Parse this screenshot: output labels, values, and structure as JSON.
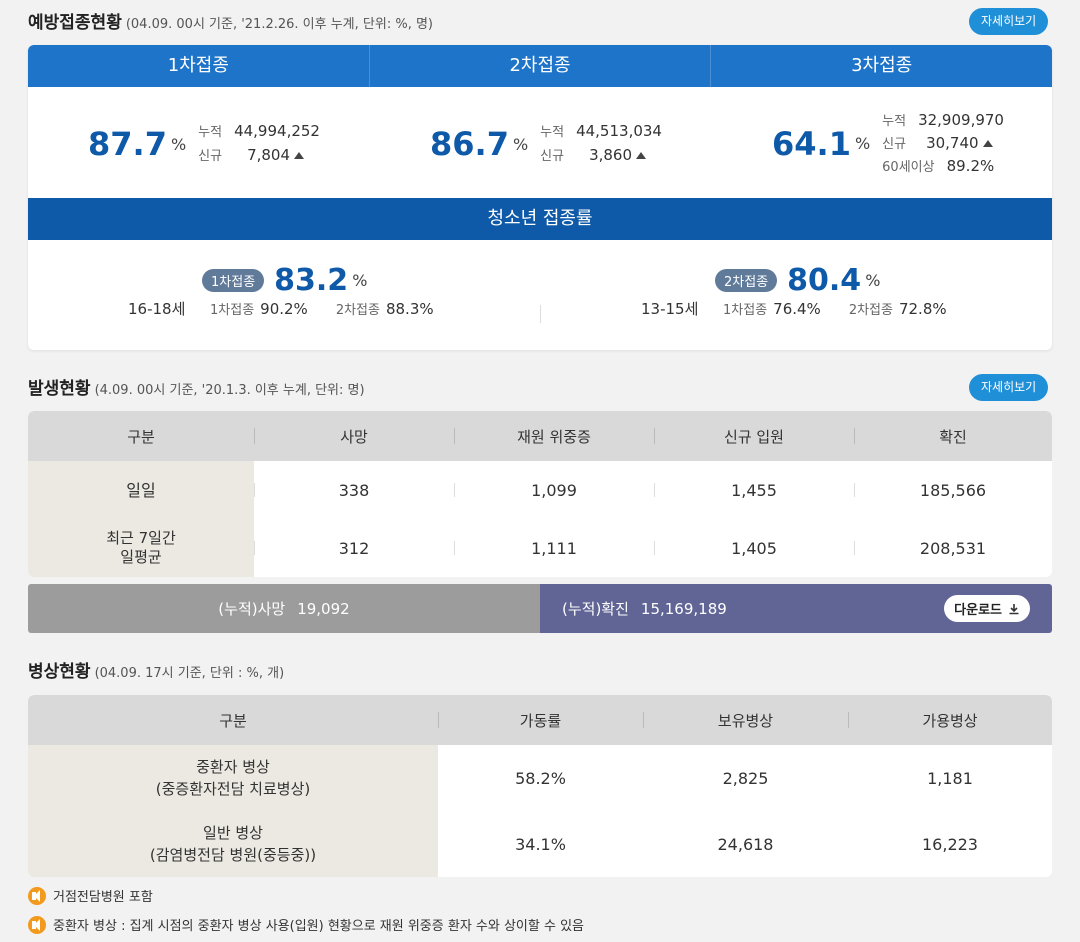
{
  "vaccination": {
    "title": "예방접종현황",
    "subtitle": "(04.09. 00시 기준, '21.2.26. 이후 누계, 단위: %, 명)",
    "more_label": "자세히보기",
    "doses": [
      {
        "name": "1차접종",
        "rate": "87.7",
        "unit": "%",
        "cum_label": "누적",
        "cum_value": "44,994,252",
        "new_label": "신규",
        "new_value": "7,804"
      },
      {
        "name": "2차접종",
        "rate": "86.7",
        "unit": "%",
        "cum_label": "누적",
        "cum_value": "44,513,034",
        "new_label": "신규",
        "new_value": "3,860"
      },
      {
        "name": "3차접종",
        "rate": "64.1",
        "unit": "%",
        "cum_label": "누적",
        "cum_value": "32,909,970",
        "new_label": "신규",
        "new_value": "30,740",
        "age_label": "60세이상",
        "age_value": "89.2%"
      }
    ],
    "teen": {
      "title": "청소년 접종률",
      "groups": [
        {
          "age": "16-18세",
          "pill": "1차접종",
          "rate": "83.2",
          "unit": "%",
          "d1_label": "1차접종",
          "d1_value": "90.2%",
          "d2_label": "2차접종",
          "d2_value": "88.3%"
        },
        {
          "age": "13-15세",
          "pill": "2차접종",
          "rate": "80.4",
          "unit": "%",
          "d1_label": "1차접종",
          "d1_value": "76.4%",
          "d2_label": "2차접종",
          "d2_value": "72.8%"
        }
      ]
    }
  },
  "occurrence": {
    "title": "발생현황",
    "subtitle": "(4.09. 00시 기준, '20.1.3. 이후 누계, 단위: 명)",
    "more_label": "자세히보기",
    "headers": [
      "구분",
      "사망",
      "재원 위중증",
      "신규 입원",
      "확진"
    ],
    "rows": [
      {
        "label": "일일",
        "values": [
          "338",
          "1,099",
          "1,455",
          "185,566"
        ]
      },
      {
        "label": "최근 7일간\n일평균",
        "values": [
          "312",
          "1,111",
          "1,405",
          "208,531"
        ]
      }
    ],
    "cum_death_label": "(누적)사망",
    "cum_death_value": "19,092",
    "cum_conf_label": "(누적)확진",
    "cum_conf_value": "15,169,189",
    "download_label": "다운로드"
  },
  "beds": {
    "title": "병상현황",
    "subtitle": "(04.09. 17시 기준, 단위 : %, 개)",
    "headers": [
      "구분",
      "가동률",
      "보유병상",
      "가용병상"
    ],
    "rows": [
      {
        "label": "중환자 병상\n(중증환자전담 치료병상)",
        "values": [
          "58.2%",
          "2,825",
          "1,181"
        ]
      },
      {
        "label": "일반 병상\n(감염병전담 병원(중등중))",
        "values": [
          "34.1%",
          "24,618",
          "16,223"
        ]
      }
    ]
  },
  "notes": [
    "거점전담병원 포함",
    "중환자 병상 : 집계 시점의 중환자 병상 사용(입원) 현황으로 재원 위중증 환자 수와 상이할 수 있음"
  ]
}
